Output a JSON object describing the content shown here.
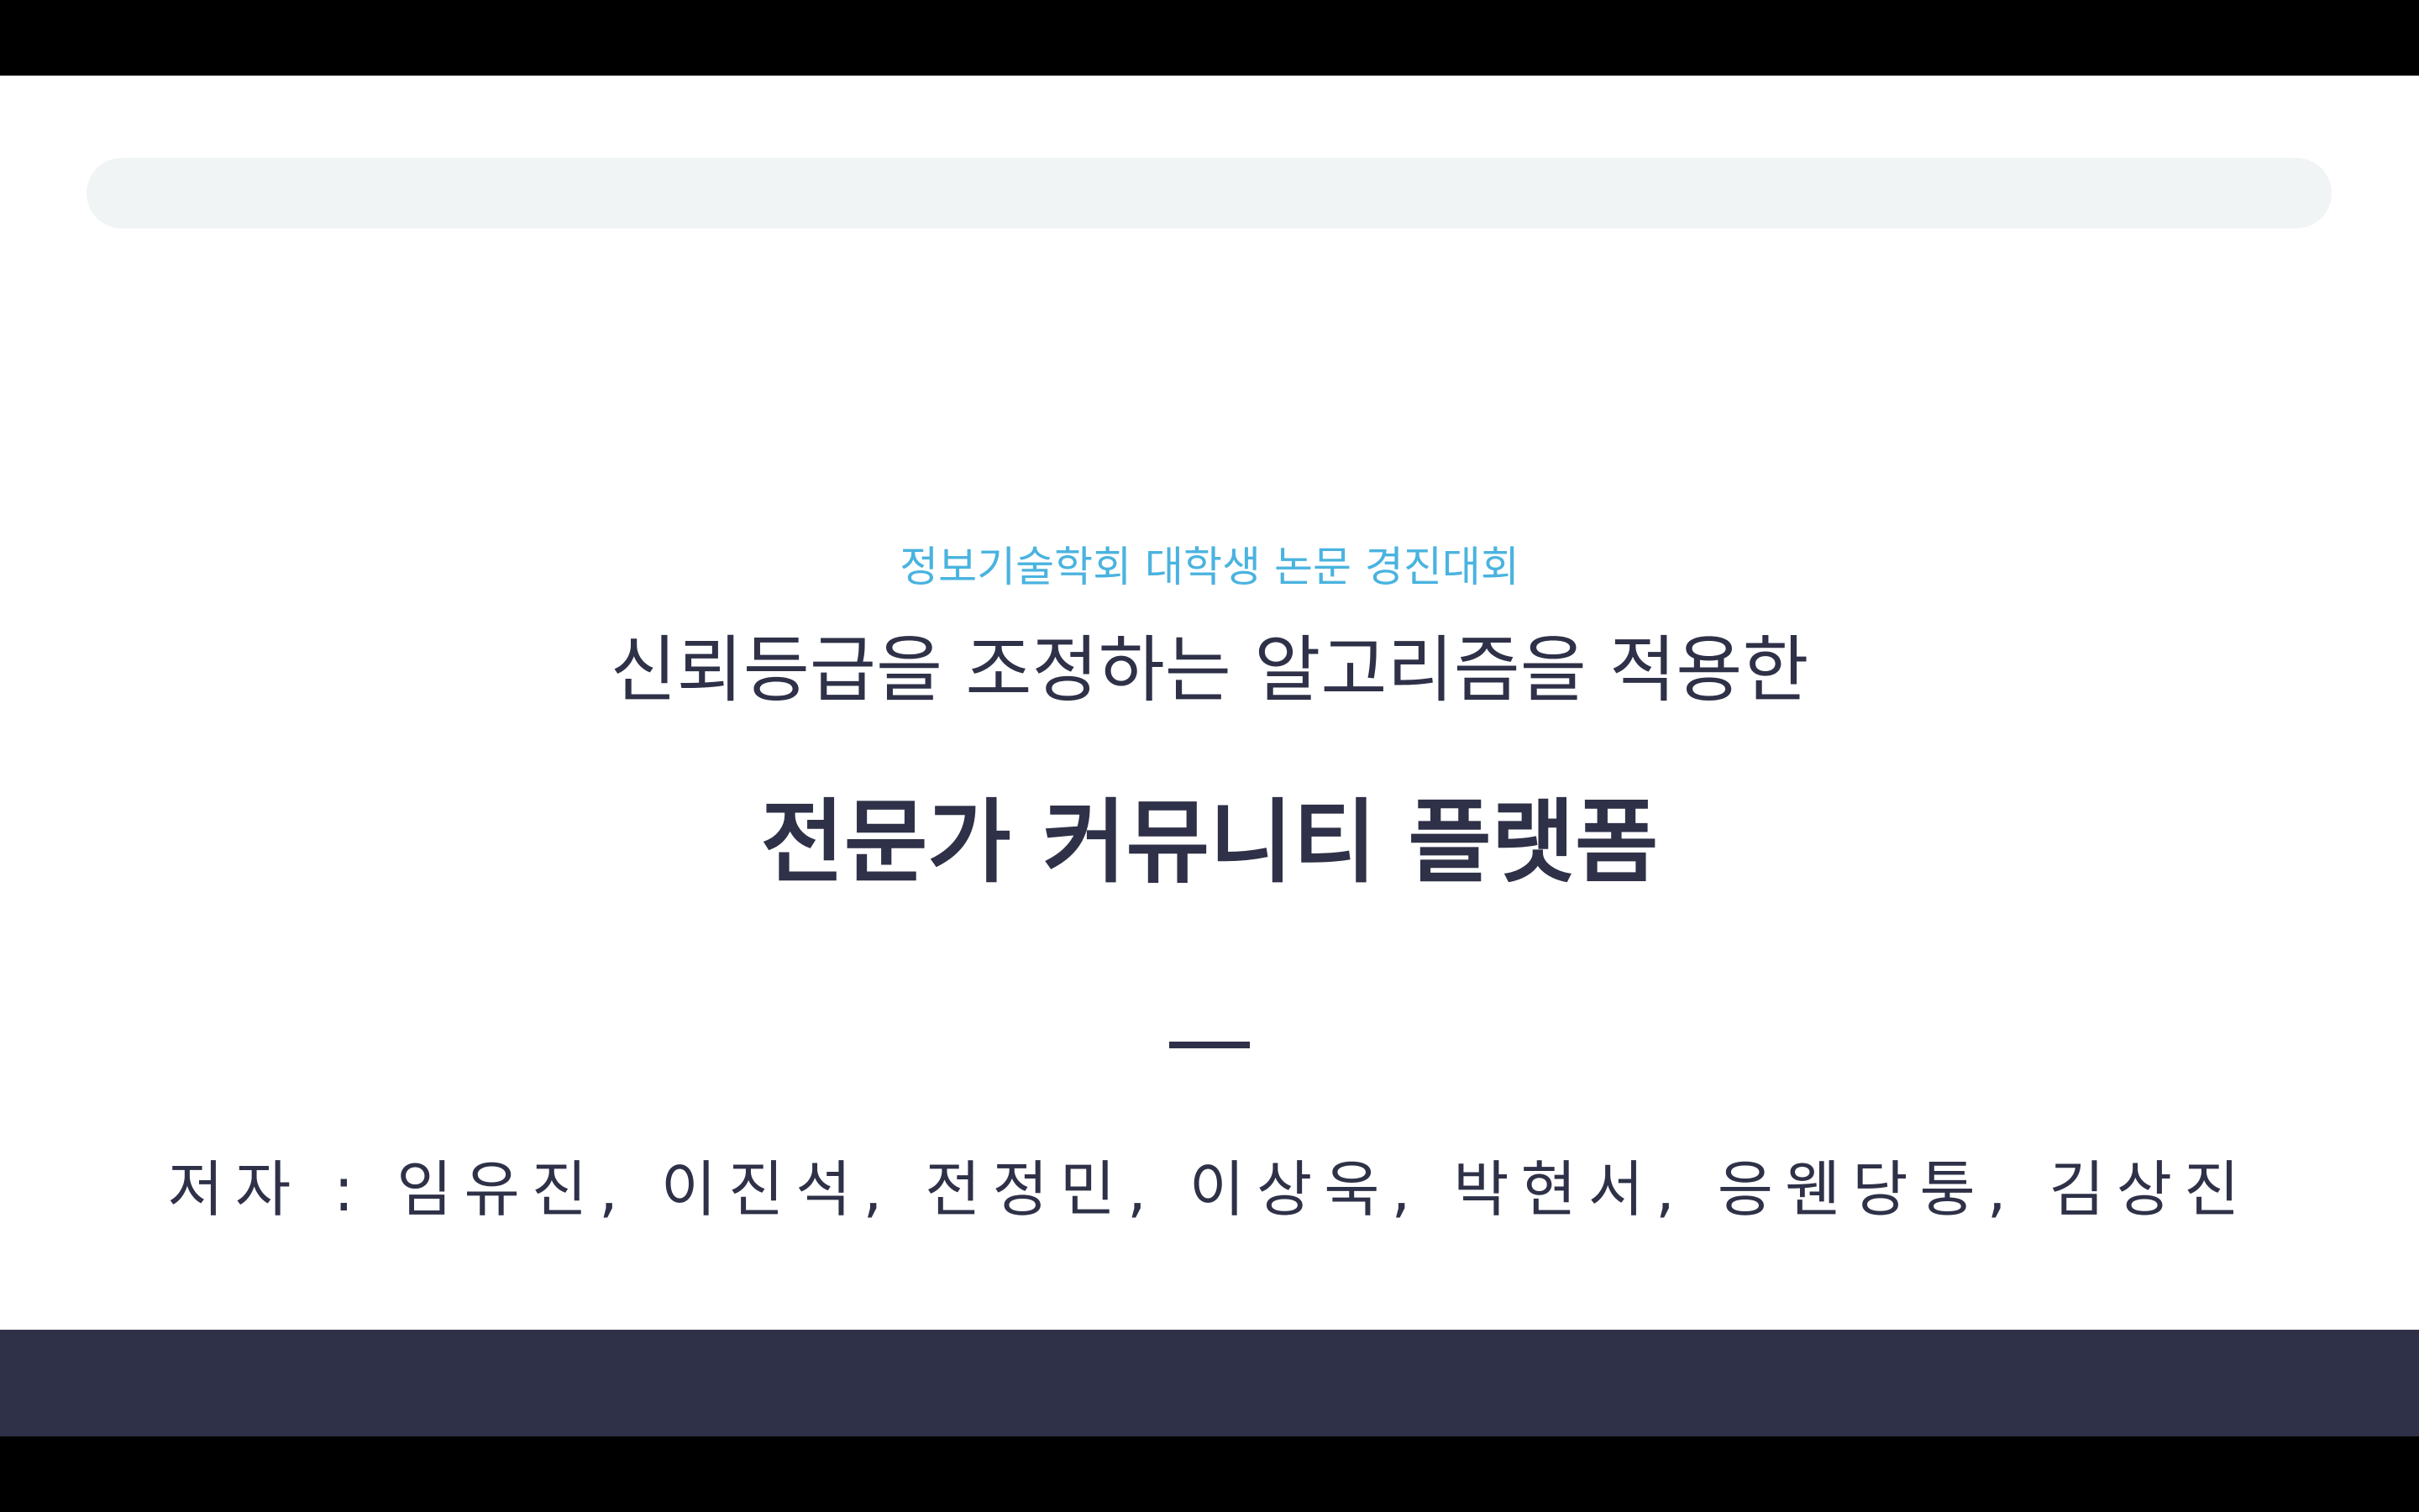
{
  "slide": {
    "conference": "정보기술학회 대학생 논문 경진대회",
    "subtitle": "신뢰등급을 조정하는 알고리즘을 적용한",
    "title": "전문가 커뮤니티 플랫폼",
    "authors": "저자 : 임유진, 이진석, 전정민, 이상욱, 박현서, 응웬당퉁, 김상진"
  },
  "colors": {
    "accent": "#4ab3df",
    "text": "#2e3147",
    "progress_track": "#f1f4f5",
    "footer": "#2e3147",
    "background": "#ffffff"
  }
}
